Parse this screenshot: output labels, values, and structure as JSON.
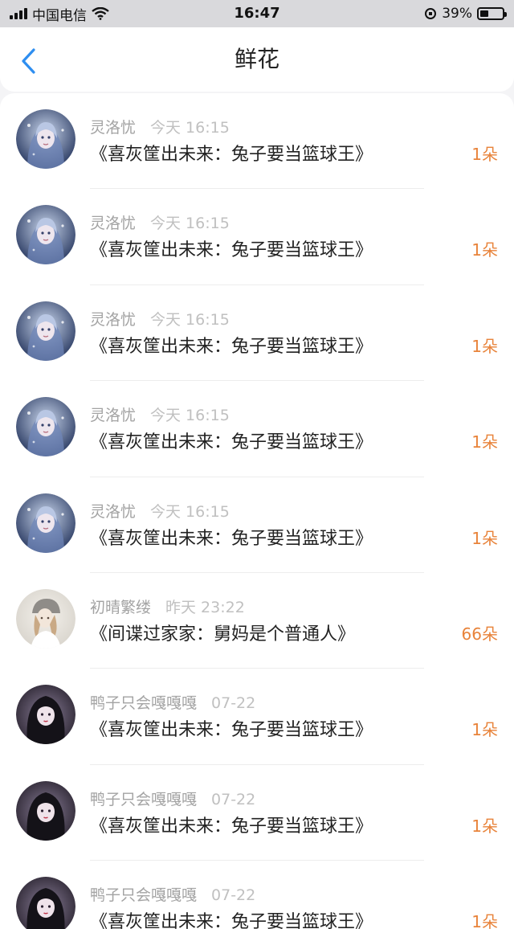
{
  "status_bar": {
    "carrier": "中国电信",
    "time": "16:47",
    "battery_percent": "39%",
    "battery_level": 0.39
  },
  "nav": {
    "title": "鲜花",
    "back_icon": "chevron-left-icon"
  },
  "colors": {
    "accent_blue": "#2e8ef0",
    "count_orange": "#e8833a",
    "meta_gray": "#a3a3a3"
  },
  "items": [
    {
      "user": "灵洛忧",
      "time": "今天 16:15",
      "book": "《喜灰筐出未来：兔子要当篮球王》",
      "count": "1朵",
      "avatar": "avatar-a"
    },
    {
      "user": "灵洛忧",
      "time": "今天 16:15",
      "book": "《喜灰筐出未来：兔子要当篮球王》",
      "count": "1朵",
      "avatar": "avatar-a"
    },
    {
      "user": "灵洛忧",
      "time": "今天 16:15",
      "book": "《喜灰筐出未来：兔子要当篮球王》",
      "count": "1朵",
      "avatar": "avatar-a"
    },
    {
      "user": "灵洛忧",
      "time": "今天 16:15",
      "book": "《喜灰筐出未来：兔子要当篮球王》",
      "count": "1朵",
      "avatar": "avatar-a"
    },
    {
      "user": "灵洛忧",
      "time": "今天 16:15",
      "book": "《喜灰筐出未来：兔子要当篮球王》",
      "count": "1朵",
      "avatar": "avatar-a"
    },
    {
      "user": "初晴繁缕",
      "time": "昨天 23:22",
      "book": "《间谍过家家：舅妈是个普通人》",
      "count": "66朵",
      "avatar": "avatar-b"
    },
    {
      "user": "鸭子只会嘎嘎嘎",
      "time": "07-22",
      "book": "《喜灰筐出未来：兔子要当篮球王》",
      "count": "1朵",
      "avatar": "avatar-c"
    },
    {
      "user": "鸭子只会嘎嘎嘎",
      "time": "07-22",
      "book": "《喜灰筐出未来：兔子要当篮球王》",
      "count": "1朵",
      "avatar": "avatar-c"
    },
    {
      "user": "鸭子只会嘎嘎嘎",
      "time": "07-22",
      "book": "《喜灰筐出未来：兔子要当篮球王》",
      "count": "1朵",
      "avatar": "avatar-c"
    }
  ]
}
